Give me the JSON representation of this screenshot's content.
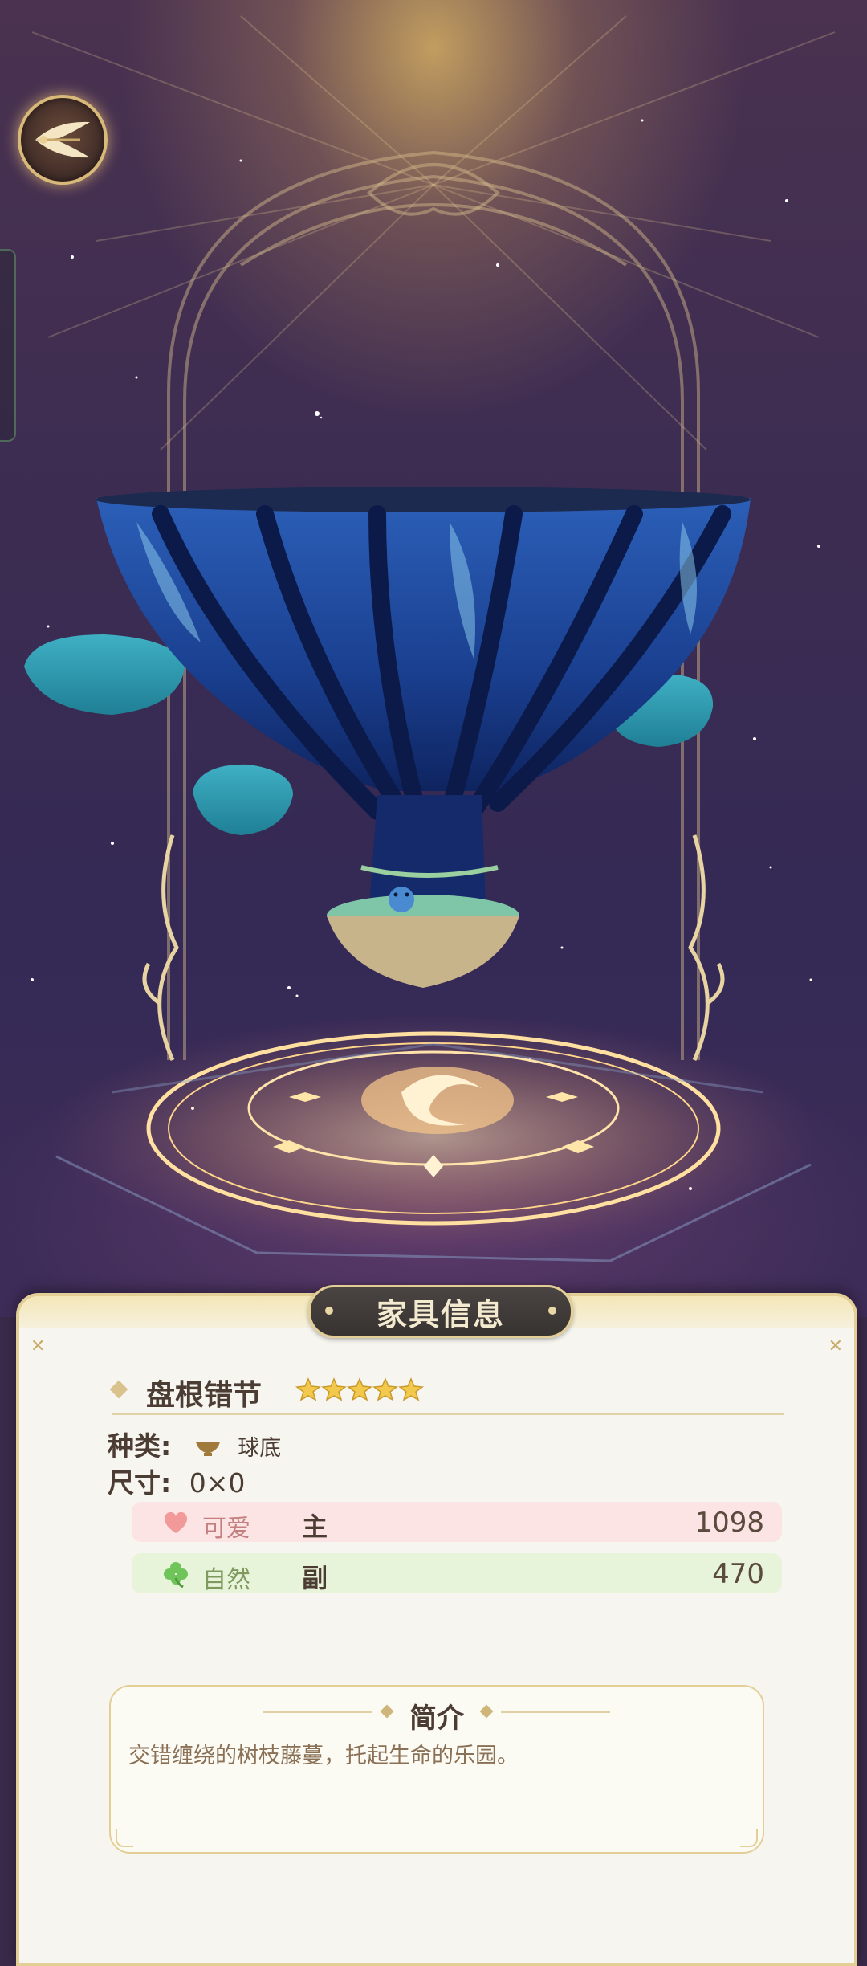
{
  "panel": {
    "title": "家具信息",
    "item_name": "盘根错节",
    "stars": 5,
    "type_label": "种类:",
    "type_value": "球底",
    "type_icon": "bowl-base-icon",
    "size_label": "尺寸:",
    "size_value": "0×0",
    "attributes": [
      {
        "name": "可爱",
        "role": "主",
        "value": "1098",
        "icon": "heart-icon",
        "color": "#f29a9a"
      },
      {
        "name": "自然",
        "role": "副",
        "value": "470",
        "icon": "clover-icon",
        "color": "#6fc45a"
      }
    ],
    "intro_title": "简介",
    "intro_text": "交错缠绕的树枝藤蔓，托起生命的乐园。"
  },
  "nav": {
    "back_icon": "wing-back-icon"
  }
}
